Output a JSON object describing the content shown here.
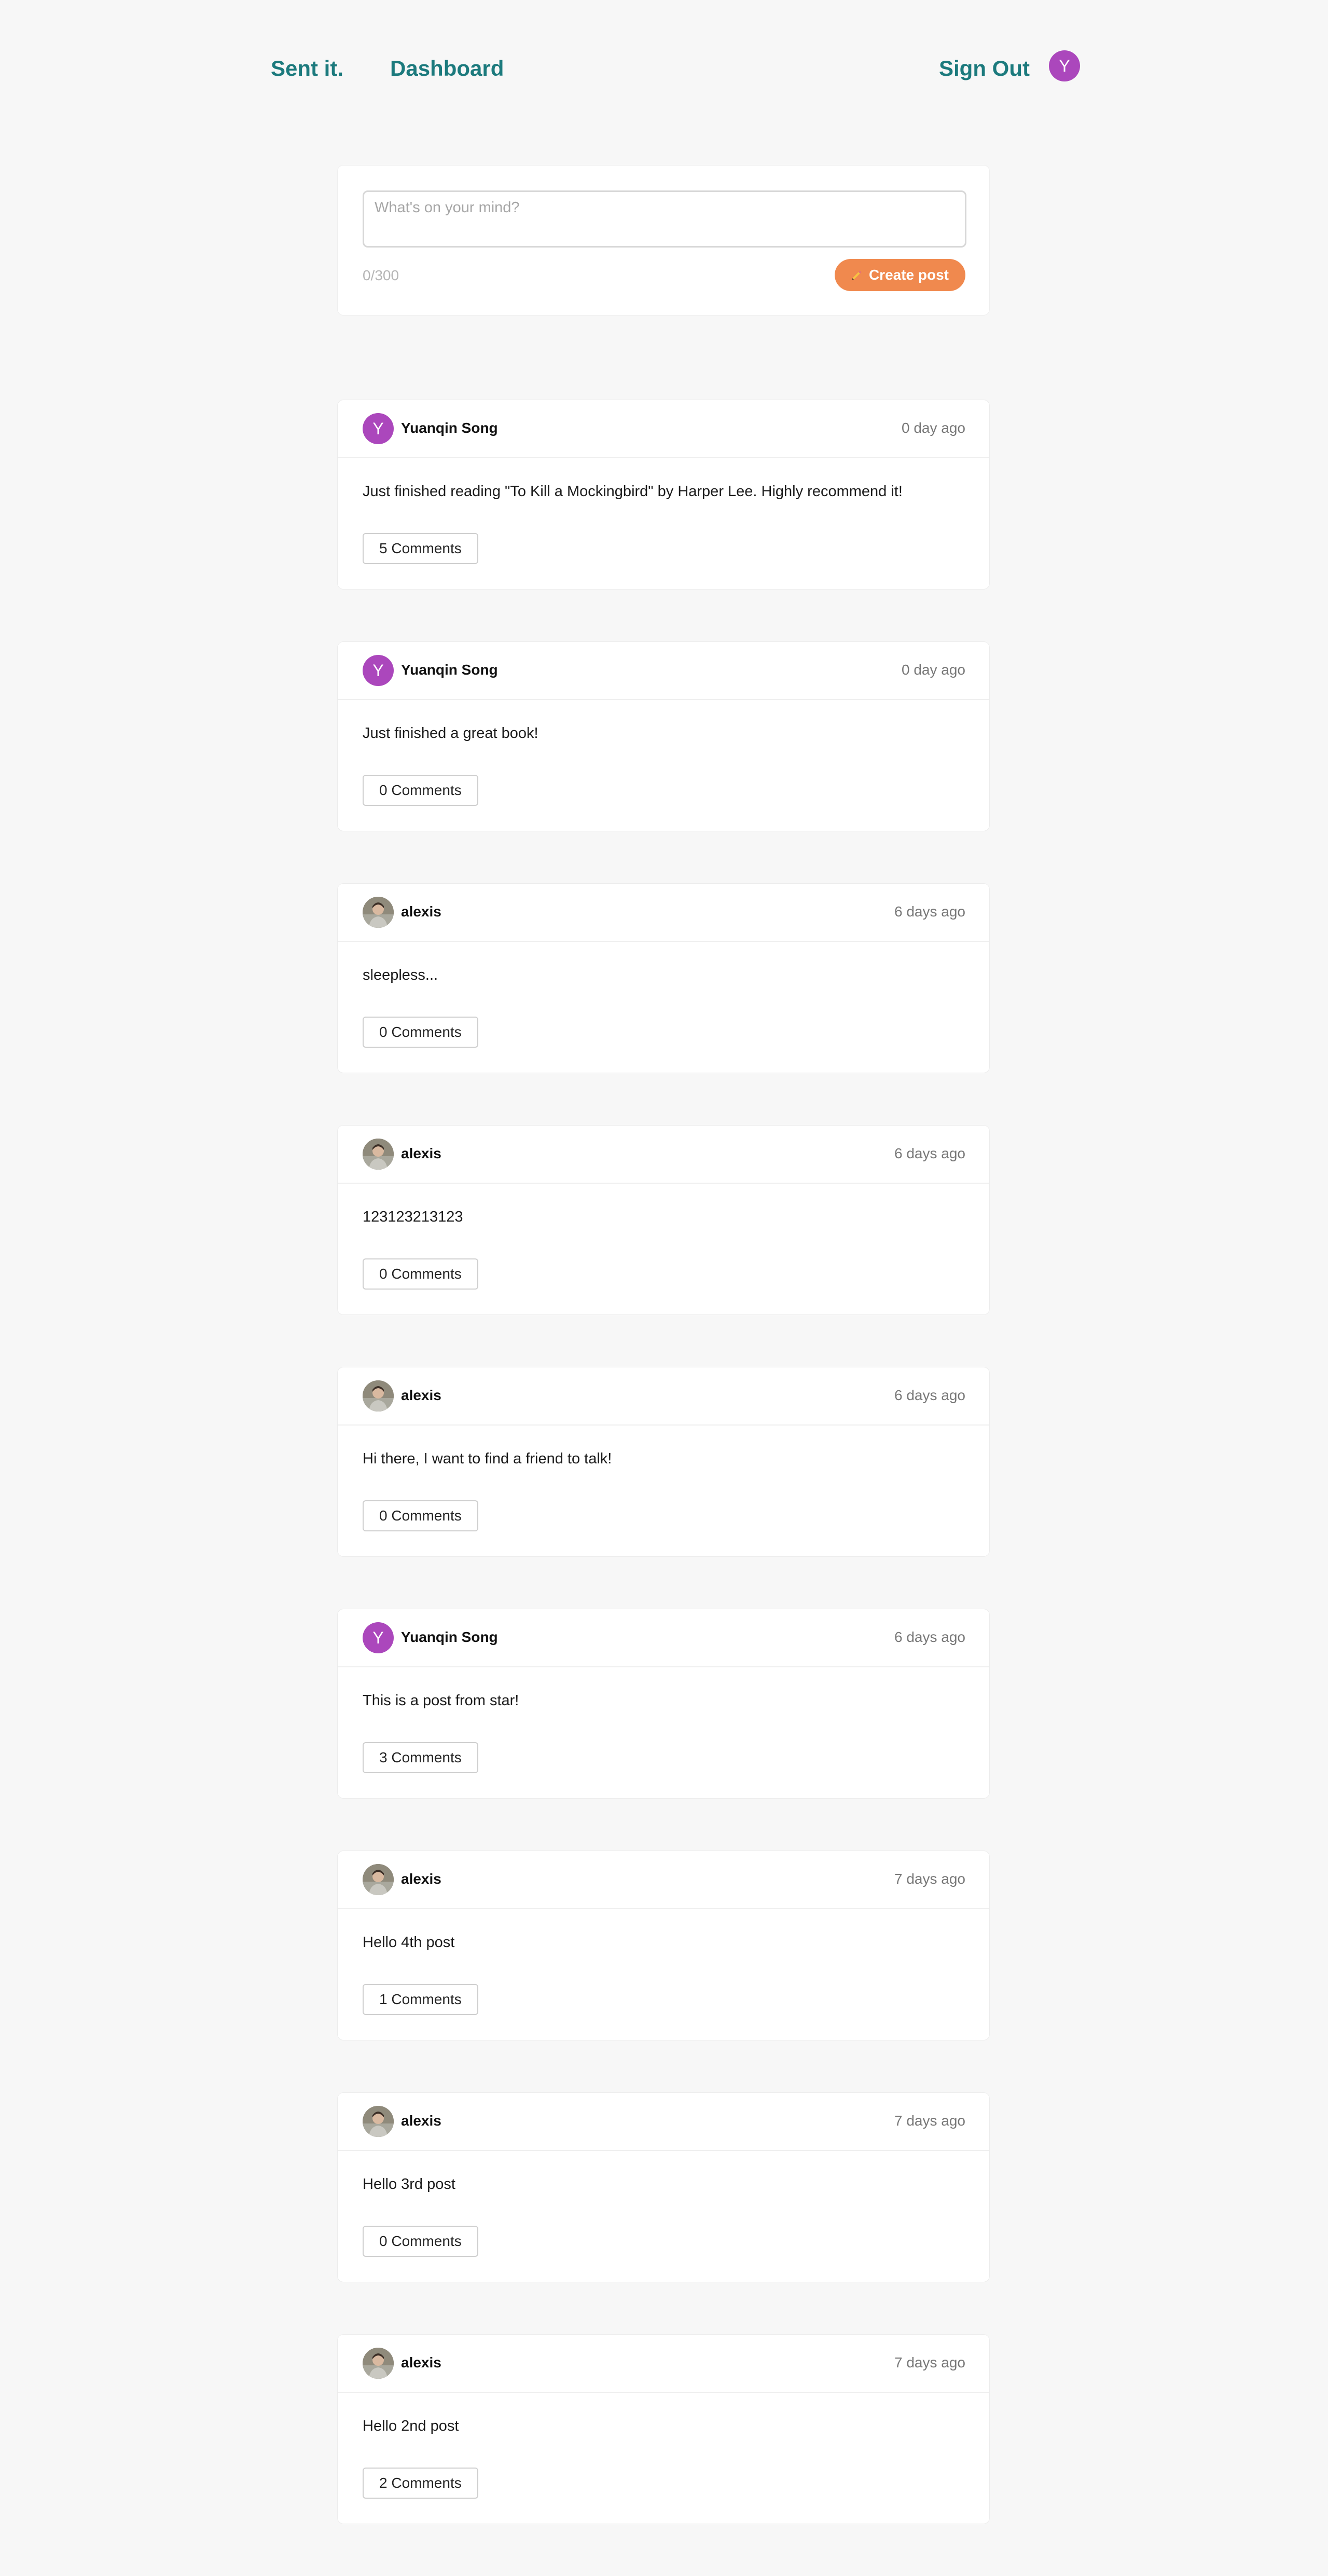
{
  "nav": {
    "brand": "Sent it.",
    "dashboard": "Dashboard",
    "sign_out": "Sign Out",
    "user_initial": "Y"
  },
  "composer": {
    "placeholder": "What's on your mind?",
    "value": "",
    "counter": "0/300",
    "button_label": "Create post"
  },
  "colors": {
    "accent_teal": "#1c7a7d",
    "button_orange": "#f0894e",
    "avatar_purple": "#ab47bc"
  },
  "posts": [
    {
      "author": "Yuanqin Song",
      "avatar": "Y",
      "avatar_type": "letter",
      "time": "0 day ago",
      "text": "Just finished reading \"To Kill a Mockingbird\" by Harper Lee. Highly recommend it!",
      "comments": "5 Comments"
    },
    {
      "author": "Yuanqin Song",
      "avatar": "Y",
      "avatar_type": "letter",
      "time": "0 day ago",
      "text": "Just finished a great book!",
      "comments": "0 Comments"
    },
    {
      "author": "alexis",
      "avatar": "",
      "avatar_type": "photo",
      "time": "6 days ago",
      "text": "sleepless...",
      "comments": "0 Comments"
    },
    {
      "author": "alexis",
      "avatar": "",
      "avatar_type": "photo",
      "time": "6 days ago",
      "text": "123123213123",
      "comments": "0 Comments"
    },
    {
      "author": "alexis",
      "avatar": "",
      "avatar_type": "photo",
      "time": "6 days ago",
      "text": "Hi there, I want to find a friend to talk!",
      "comments": "0 Comments"
    },
    {
      "author": "Yuanqin Song",
      "avatar": "Y",
      "avatar_type": "letter",
      "time": "6 days ago",
      "text": "This is a post from star!",
      "comments": "3 Comments"
    },
    {
      "author": "alexis",
      "avatar": "",
      "avatar_type": "photo",
      "time": "7 days ago",
      "text": "Hello 4th post",
      "comments": "1 Comments"
    },
    {
      "author": "alexis",
      "avatar": "",
      "avatar_type": "photo",
      "time": "7 days ago",
      "text": "Hello 3rd post",
      "comments": "0 Comments"
    },
    {
      "author": "alexis",
      "avatar": "",
      "avatar_type": "photo",
      "time": "7 days ago",
      "text": "Hello 2nd post",
      "comments": "2 Comments"
    }
  ]
}
